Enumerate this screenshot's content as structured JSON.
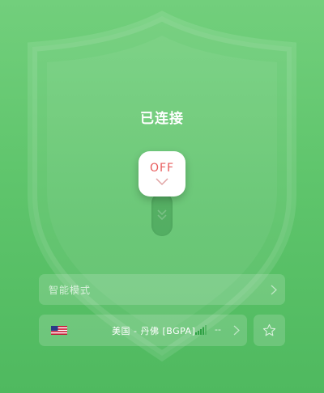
{
  "status": {
    "title": "已连接"
  },
  "toggle": {
    "label": "OFF",
    "knob_text_color": "#e85c5c"
  },
  "mode": {
    "label": "智能模式"
  },
  "server": {
    "flag_icon": "us-flag-icon",
    "name": "美国 - 丹佛 [BGPA]",
    "latency": "--",
    "signal_icon": "signal-bars-icon"
  },
  "favorite": {
    "icon": "star-outline-icon"
  },
  "colors": {
    "background_top": "#72cf7c",
    "background_bottom": "#4fb95f",
    "signal_green": "#2ea043"
  }
}
